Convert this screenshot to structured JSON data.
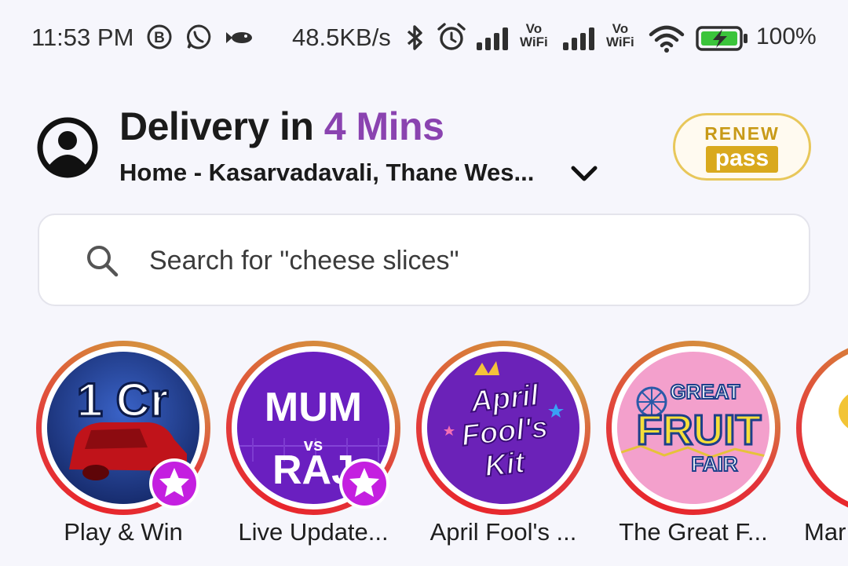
{
  "status_bar": {
    "time": "11:53 PM",
    "speed": "48.5KB/s",
    "vowifi_top": "Vo",
    "vowifi_bottom": "WiFi",
    "battery_percent": "100%",
    "icons": [
      "b-circle-icon",
      "whatsapp-icon",
      "fish-icon",
      "bluetooth-icon",
      "alarm-icon",
      "signal-icon",
      "wifi-icon",
      "battery-charging-icon"
    ]
  },
  "header": {
    "delivery_prefix": "Delivery in ",
    "delivery_time": "4 Mins",
    "address": "Home - Kasarvadavali, Thane Wes...",
    "renew_top": "RENEW",
    "renew_pass": "pass"
  },
  "search": {
    "placeholder": "Search for \"cheese slices\""
  },
  "stories": [
    {
      "label": "Play & Win",
      "art_text": "1 Cr",
      "badge": true
    },
    {
      "label": "Live Update...",
      "art_text_top": "MUM",
      "art_text_mid": "vs",
      "art_text_bottom": "RAJ",
      "badge": true
    },
    {
      "label": "April Fool's ...",
      "art_text_1": "April",
      "art_text_2": "Fool's",
      "art_text_3": "Kit",
      "badge": false
    },
    {
      "label": "The Great F...",
      "art_text_1": "GREAT",
      "art_text_2": "FRUIT",
      "art_text_3": "FAIR",
      "badge": false
    },
    {
      "label": "Mar",
      "badge": false
    }
  ],
  "colors": {
    "accent_purple": "#8a43b0",
    "ring_red": "#e8262b",
    "pass_gold": "#d9a91d",
    "story_blue": "#203d8f",
    "story_purple": "#6a1fc0",
    "story_pink": "#f3a0cc"
  }
}
